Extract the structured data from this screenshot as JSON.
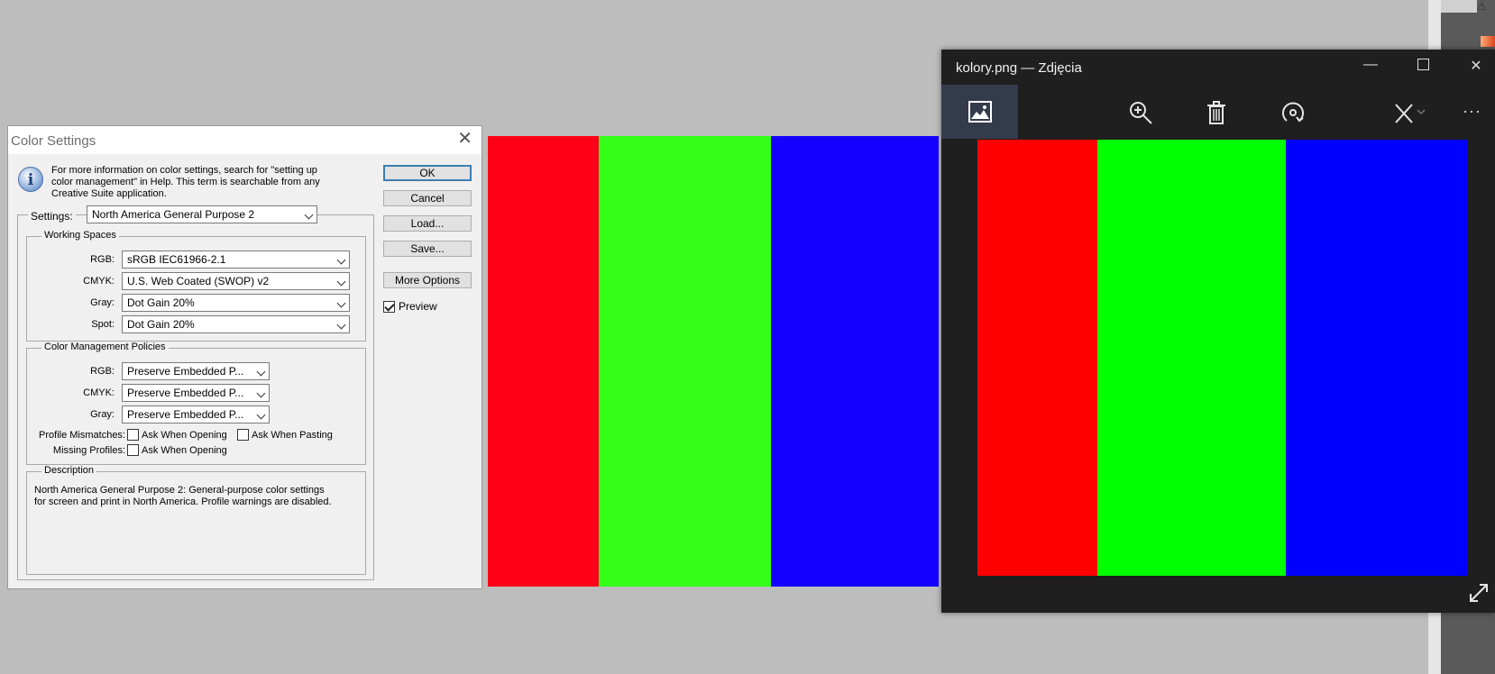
{
  "background": {
    "colors": {
      "workspace": "#bdbdbd"
    },
    "right_edge_icon": "warning-icon"
  },
  "canvas_image": {
    "bars": [
      {
        "color": "#ff0019",
        "fraction": 0.246
      },
      {
        "color": "#33ff19",
        "fraction": 0.382
      },
      {
        "color": "#1400ff",
        "fraction": 0.372
      }
    ]
  },
  "color_settings": {
    "title": "Color Settings",
    "info_text": "For more information on color settings, search for \"setting up color management\" in Help. This term is searchable from any Creative Suite application.",
    "buttons": {
      "ok": "OK",
      "cancel": "Cancel",
      "load": "Load...",
      "save": "Save...",
      "more_options": "More Options"
    },
    "preview": {
      "label": "Preview",
      "checked": true
    },
    "settings": {
      "label": "Settings:",
      "value": "North America General Purpose 2"
    },
    "working_spaces": {
      "label": "Working Spaces",
      "rgb": {
        "label": "RGB:",
        "value": "sRGB IEC61966-2.1"
      },
      "cmyk": {
        "label": "CMYK:",
        "value": "U.S. Web Coated (SWOP) v2"
      },
      "gray": {
        "label": "Gray:",
        "value": "Dot Gain 20%"
      },
      "spot": {
        "label": "Spot:",
        "value": "Dot Gain 20%"
      }
    },
    "policies": {
      "label": "Color Management Policies",
      "rgb": {
        "label": "RGB:",
        "value": "Preserve Embedded P..."
      },
      "cmyk": {
        "label": "CMYK:",
        "value": "Preserve Embedded P..."
      },
      "gray": {
        "label": "Gray:",
        "value": "Preserve Embedded P..."
      },
      "profile_mismatches": {
        "label": "Profile Mismatches:",
        "ask_opening": "Ask When Opening",
        "ask_pasting": "Ask When Pasting"
      },
      "missing_profiles": {
        "label": "Missing Profiles:",
        "ask_opening": "Ask When Opening"
      }
    },
    "description": {
      "label": "Description",
      "text": "North America General Purpose 2:  General-purpose color settings for screen and print in North America. Profile warnings are disabled."
    }
  },
  "photos_viewer": {
    "title": "kolory.png — Zdjęcia",
    "toolbar_icons": [
      "image-icon",
      "zoom-in-icon",
      "delete-icon",
      "rotate-icon",
      "edit-icon",
      "more-icon"
    ],
    "more_label": "···",
    "image": {
      "bars": [
        {
          "color": "#ff0000",
          "fraction": 0.245
        },
        {
          "color": "#00ff00",
          "fraction": 0.385
        },
        {
          "color": "#0000ff",
          "fraction": 0.37
        }
      ]
    },
    "colors": {
      "background": "#1f1f1f",
      "selected_tool": "#343b4c"
    }
  }
}
